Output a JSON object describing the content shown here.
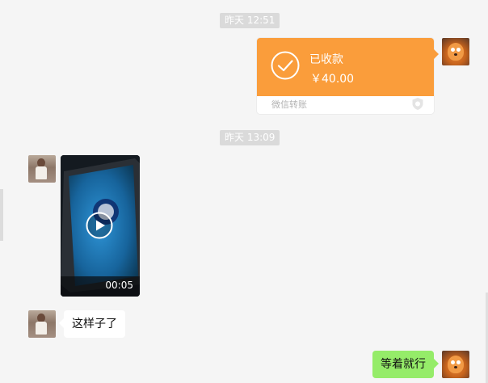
{
  "timestamps": {
    "first": "昨天 12:51",
    "second": "昨天 13:09"
  },
  "transfer": {
    "status": "已收款",
    "amount": "￥40.00",
    "footer": "微信转账",
    "accent_color": "#fa9d3b",
    "icon": "check-circle-icon"
  },
  "video": {
    "duration": "00:05",
    "icon": "play-icon"
  },
  "messages": {
    "incoming_text": "这样子了",
    "outgoing_text": "等着就行"
  },
  "colors": {
    "background": "#f5f5f5",
    "outgoing_bubble": "#95ec69",
    "incoming_bubble": "#ffffff",
    "timestamp_bg": "#dadada"
  }
}
